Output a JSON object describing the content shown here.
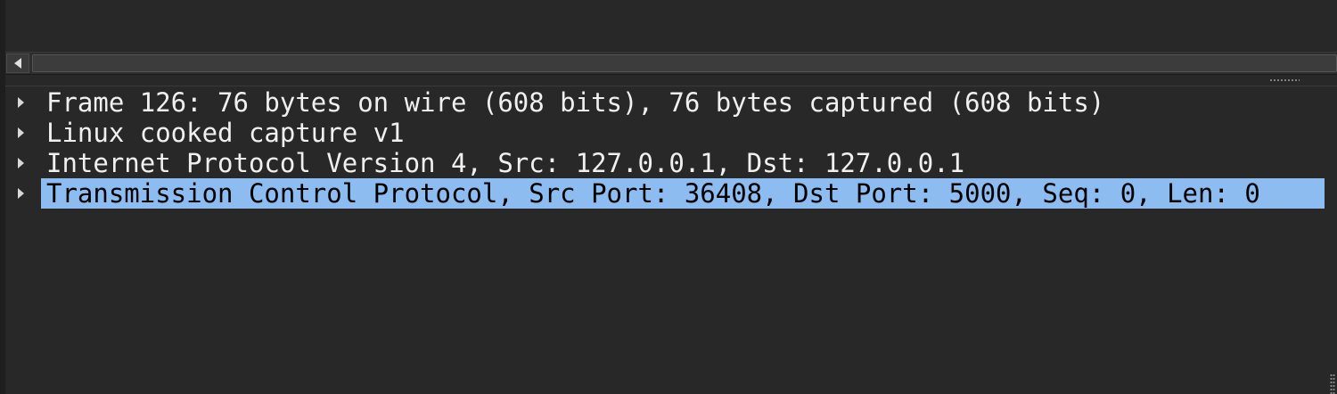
{
  "tree": {
    "items": [
      {
        "label": "Frame 126: 76 bytes on wire (608 bits), 76 bytes captured (608 bits)",
        "selected": false
      },
      {
        "label": "Linux cooked capture v1",
        "selected": false
      },
      {
        "label": "Internet Protocol Version 4, Src: 127.0.0.1, Dst: 127.0.0.1",
        "selected": false
      },
      {
        "label": "Transmission Control Protocol, Src Port: 36408, Dst Port: 5000, Seq: 0, Len: 0",
        "selected": true
      }
    ]
  },
  "colors": {
    "background": "#282828",
    "selection": "#8cbcf0",
    "text": "#f0f0f0"
  },
  "icons": {
    "scroll_left": "triangle-left-icon",
    "expander": "triangle-right-icon"
  }
}
